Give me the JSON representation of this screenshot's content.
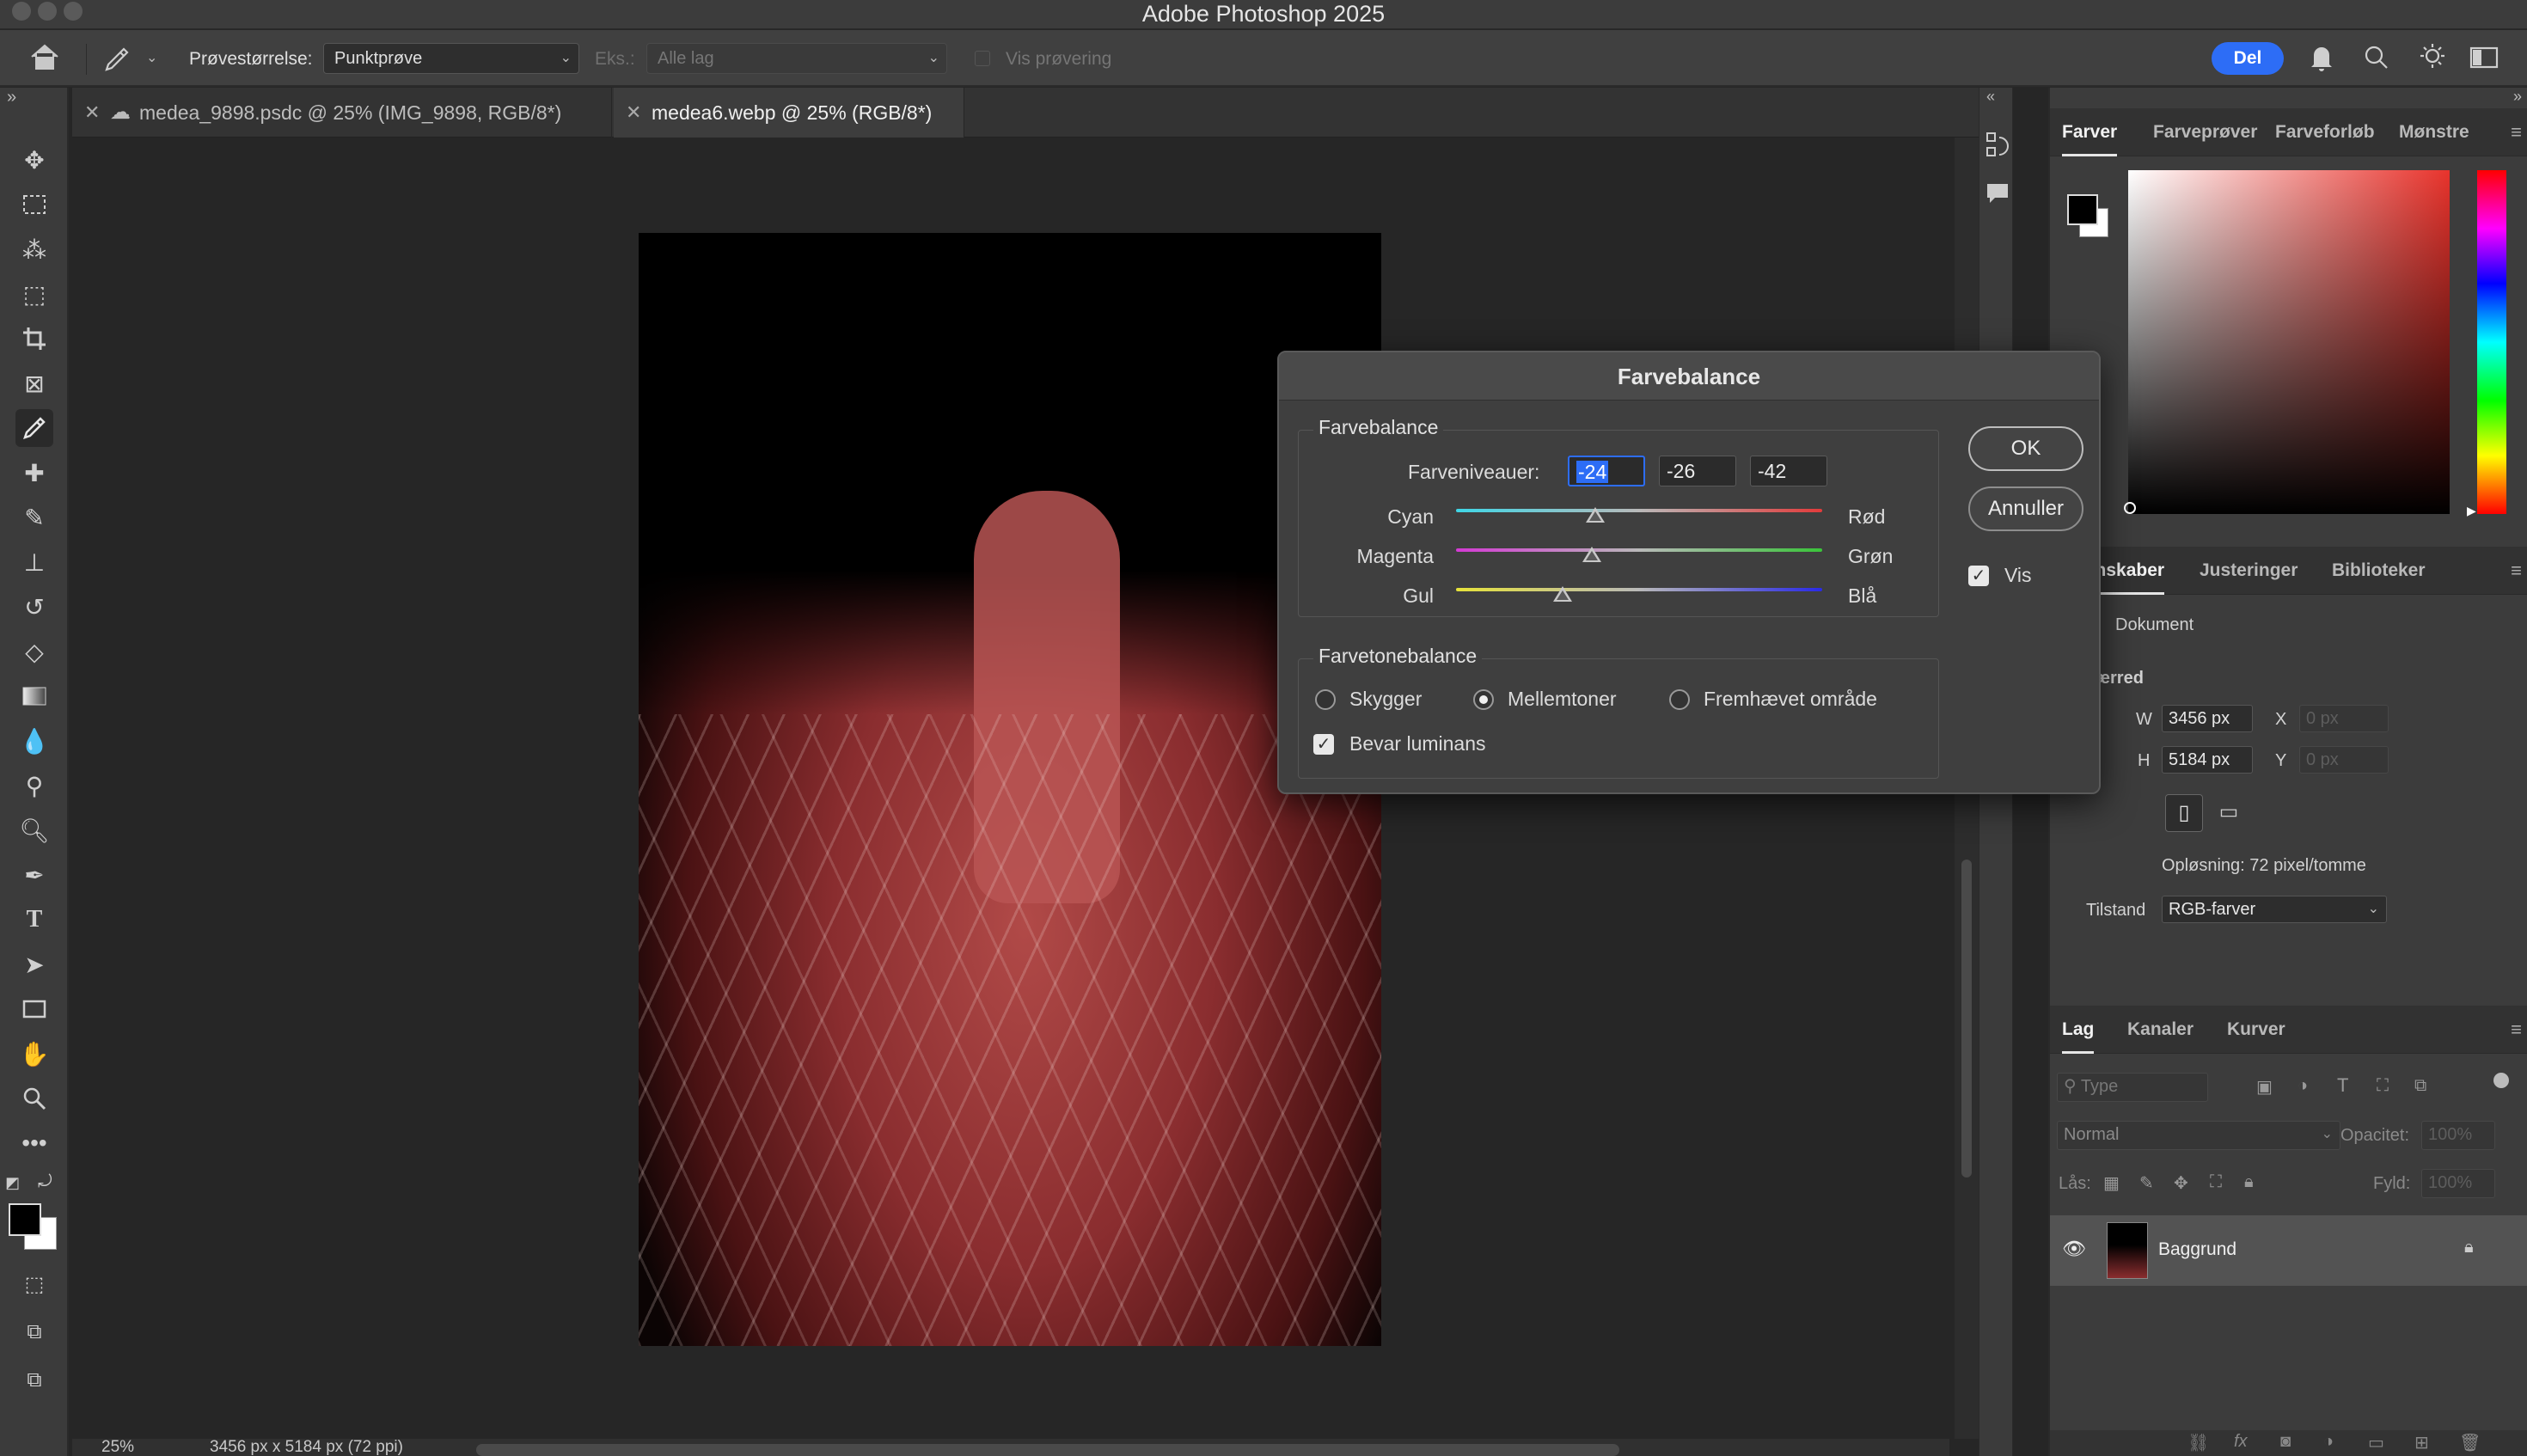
{
  "app": {
    "title": "Adobe Photoshop 2025"
  },
  "options_bar": {
    "sample_size_label": "Prøvestørrelse:",
    "sample_size_value": "Punktprøve",
    "sample_label": "Eks.:",
    "sample_value": "Alle lag",
    "show_sampling_label": "Vis prøvering",
    "share_label": "Del"
  },
  "tabs": [
    {
      "label": "medea_9898.psdc @ 25% (IMG_9898, RGB/8*)",
      "active": false
    },
    {
      "label": "medea6.webp @ 25% (RGB/8*)",
      "active": true
    }
  ],
  "status": {
    "zoom": "25%",
    "doc_size": "3456 px x 5184 px (72 ppi)"
  },
  "color_panel": {
    "tabs": [
      "Farver",
      "Farveprøver",
      "Farveforløb",
      "Mønstre"
    ],
    "foreground": "#000000",
    "background": "#ffffff"
  },
  "properties_panel": {
    "tabs": [
      "Egenskaber",
      "Justeringer",
      "Biblioteker"
    ],
    "doc_label": "Dokument",
    "canvas_label": "Lærred",
    "w_label": "W",
    "w_value": "3456 px",
    "h_label": "H",
    "h_value": "5184 px",
    "x_label": "X",
    "x_placeholder": "0 px",
    "y_label": "Y",
    "y_placeholder": "0 px",
    "resolution": "Opløsning: 72 pixel/tomme",
    "mode_label": "Tilstand",
    "mode_value": "RGB-farver"
  },
  "layers_panel": {
    "tabs": [
      "Lag",
      "Kanaler",
      "Kurver"
    ],
    "filter_placeholder": "Type",
    "blend_mode": "Normal",
    "opacity_label": "Opacitet:",
    "opacity_value": "100%",
    "lock_label": "Lås:",
    "fill_label": "Fyld:",
    "fill_value": "100%",
    "layer_name": "Baggrund"
  },
  "dialog": {
    "title": "Farvebalance",
    "balance_group": "Farvebalance",
    "levels_label": "Farveniveauer:",
    "levels": [
      "-24",
      "-26",
      "-42"
    ],
    "sliders": [
      {
        "left": "Cyan",
        "right": "Rød",
        "value": -24
      },
      {
        "left": "Magenta",
        "right": "Grøn",
        "value": -26
      },
      {
        "left": "Gul",
        "right": "Blå",
        "value": -42
      }
    ],
    "tone_group": "Farvetonebalance",
    "tones": [
      "Skygger",
      "Mellemtoner",
      "Fremhævet område"
    ],
    "selected_tone": "Mellemtoner",
    "preserve_luminosity": "Bevar luminans",
    "ok": "OK",
    "cancel": "Annuller",
    "preview": "Vis"
  }
}
